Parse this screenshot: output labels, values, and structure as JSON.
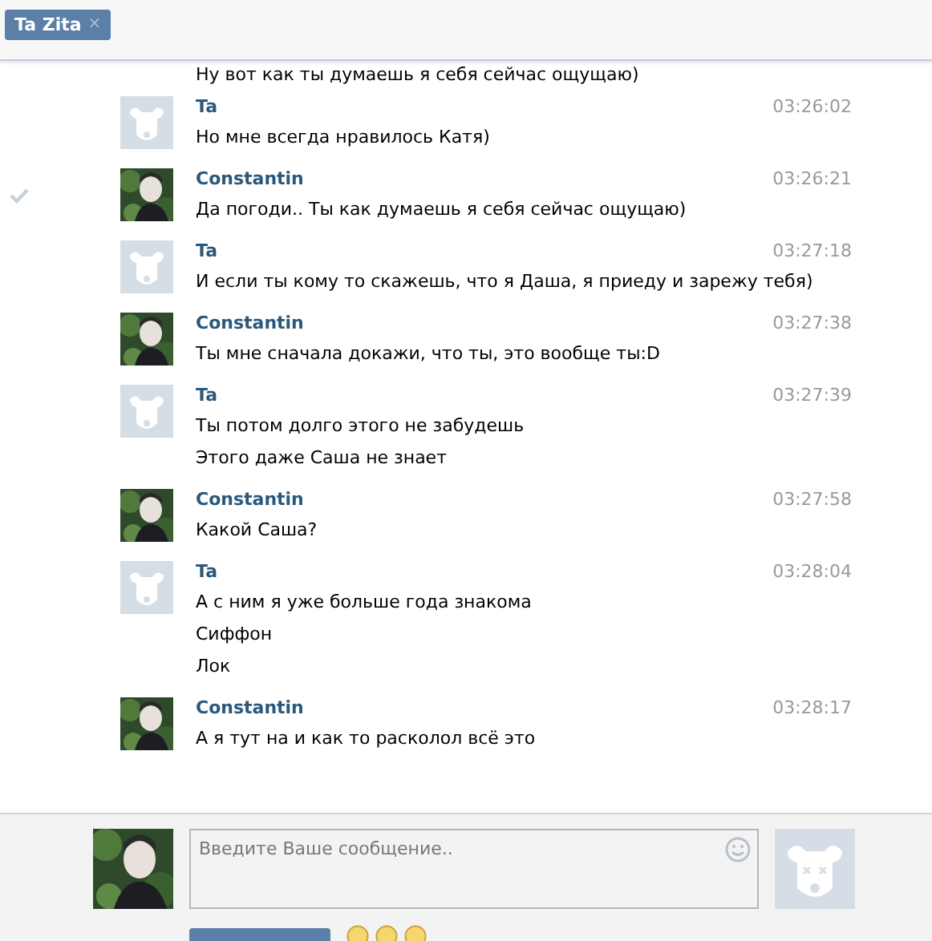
{
  "tab": {
    "label": "Ta Zita",
    "close": "✕"
  },
  "partial_line": "Ну вот как ты думаешь я себя сейчас ощущаю)",
  "messages": [
    {
      "author": "Ta",
      "kind": "dog",
      "time": "03:26:02",
      "marked": false,
      "lines": [
        "Но мне всегда нравилось Катя)"
      ]
    },
    {
      "author": "Constantin",
      "time": "03:26:21",
      "marked": true,
      "lines": [
        "Да погоди.. Ты как думаешь я себя сейчас ощущаю)"
      ]
    },
    {
      "author": "Ta",
      "kind": "dog",
      "time": "03:27:18",
      "marked": false,
      "lines": [
        "И если ты кому то скажешь, что я Даша, я приеду и зарежу тебя)"
      ]
    },
    {
      "author": "Constantin",
      "time": "03:27:38",
      "marked": false,
      "lines": [
        "Ты мне сначала докажи, что ты, это вообще ты:D"
      ]
    },
    {
      "author": "Ta",
      "kind": "dog",
      "time": "03:27:39",
      "marked": false,
      "lines": [
        "Ты потом долго этого не забудешь",
        "Этого даже Саша не знает"
      ]
    },
    {
      "author": "Constantin",
      "time": "03:27:58",
      "marked": false,
      "lines": [
        "Какой Саша?"
      ]
    },
    {
      "author": "Ta",
      "kind": "dog",
      "time": "03:28:04",
      "marked": false,
      "lines": [
        "А с ним я уже больше года знакома",
        "Сиффон",
        "Лок"
      ]
    },
    {
      "author": "Constantin",
      "time": "03:28:17",
      "marked": false,
      "lines": [
        "А я тут на и как то расколол всё это"
      ]
    }
  ],
  "composer": {
    "placeholder": "Введите Ваше сообщение..",
    "peer_avatar": {
      "kind": "dog_dead"
    }
  }
}
